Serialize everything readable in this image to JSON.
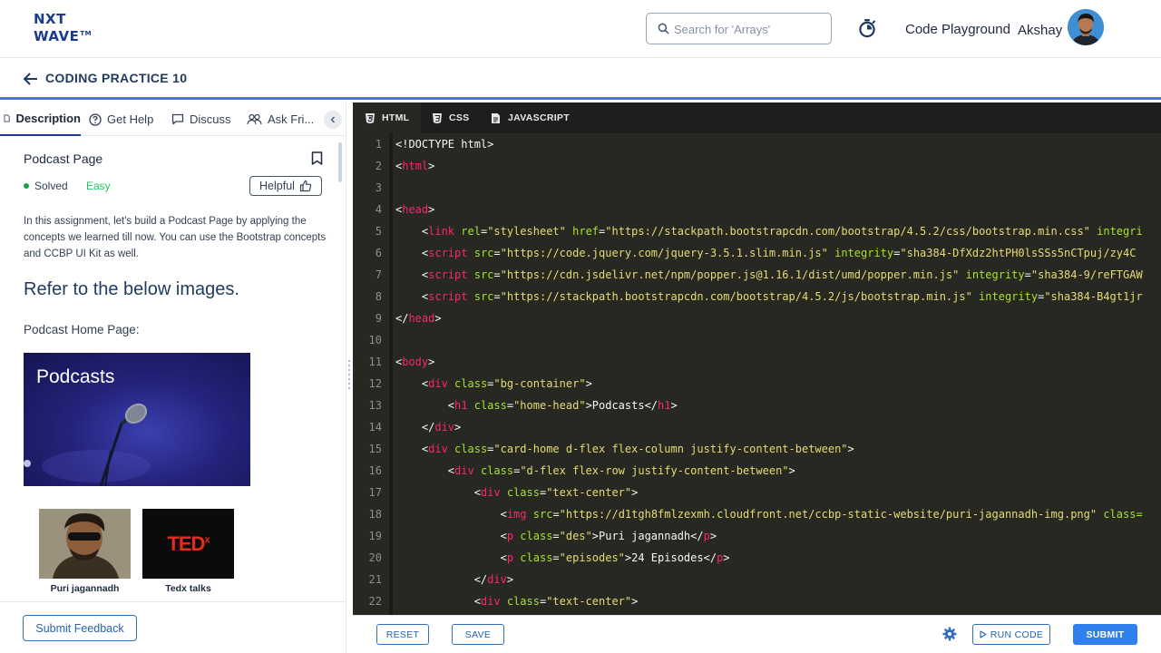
{
  "header": {
    "logo_line1": "NXT",
    "logo_line2": "WAVE",
    "logo_tm": "TM",
    "search_placeholder": "Search for 'Arrays'",
    "playground": "Code Playground",
    "username": "Akshay"
  },
  "subheader": {
    "title": "CODING PRACTICE 10"
  },
  "left_tabs": [
    {
      "label": "Description"
    },
    {
      "label": "Get Help"
    },
    {
      "label": "Discuss"
    },
    {
      "label": "Ask Fri..."
    }
  ],
  "question": {
    "title": "Podcast Page",
    "status": "Solved",
    "difficulty": "Easy",
    "helpful_label": "Helpful",
    "description": "In this assignment, let's build a Podcast Page by applying the concepts we learned till now. You can use the Bootstrap concepts and CCBP UI Kit as well.",
    "refer": "Refer to the below images.",
    "home_label": "Podcast Home Page:",
    "image_title": "Podcasts",
    "cards": [
      {
        "caption": "Puri jagannadh"
      },
      {
        "caption": "Tedx talks"
      }
    ],
    "ted_logo": "TED",
    "ted_x": "x"
  },
  "left_footer": {
    "feedback": "Submit Feedback"
  },
  "editor_tabs": [
    {
      "label": "HTML"
    },
    {
      "label": "CSS"
    },
    {
      "label": "JAVASCRIPT"
    }
  ],
  "code_lines": [
    [
      [
        "w",
        "<!DOCTYPE html>"
      ]
    ],
    [
      [
        "w",
        "<"
      ],
      [
        "t",
        "html"
      ],
      [
        "w",
        ">"
      ]
    ],
    [],
    [
      [
        "w",
        "<"
      ],
      [
        "t",
        "head"
      ],
      [
        "w",
        ">"
      ]
    ],
    [
      [
        "w",
        "    <"
      ],
      [
        "t",
        "link"
      ],
      [
        "w",
        " "
      ],
      [
        "a",
        "rel"
      ],
      [
        "w",
        "="
      ],
      [
        "s",
        "\"stylesheet\""
      ],
      [
        "w",
        " "
      ],
      [
        "a",
        "href"
      ],
      [
        "w",
        "="
      ],
      [
        "s",
        "\"https://stackpath.bootstrapcdn.com/bootstrap/4.5.2/css/bootstrap.min.css\""
      ],
      [
        "w",
        " "
      ],
      [
        "a",
        "integri"
      ]
    ],
    [
      [
        "w",
        "    <"
      ],
      [
        "t",
        "script"
      ],
      [
        "w",
        " "
      ],
      [
        "a",
        "src"
      ],
      [
        "w",
        "="
      ],
      [
        "s",
        "\"https://code.jquery.com/jquery-3.5.1.slim.min.js\""
      ],
      [
        "w",
        " "
      ],
      [
        "a",
        "integrity"
      ],
      [
        "w",
        "="
      ],
      [
        "s",
        "\"sha384-DfXdz2htPH0lsSSs5nCTpuj/zy4C"
      ]
    ],
    [
      [
        "w",
        "    <"
      ],
      [
        "t",
        "script"
      ],
      [
        "w",
        " "
      ],
      [
        "a",
        "src"
      ],
      [
        "w",
        "="
      ],
      [
        "s",
        "\"https://cdn.jsdelivr.net/npm/popper.js@1.16.1/dist/umd/popper.min.js\""
      ],
      [
        "w",
        " "
      ],
      [
        "a",
        "integrity"
      ],
      [
        "w",
        "="
      ],
      [
        "s",
        "\"sha384-9/reFTGAW"
      ]
    ],
    [
      [
        "w",
        "    <"
      ],
      [
        "t",
        "script"
      ],
      [
        "w",
        " "
      ],
      [
        "a",
        "src"
      ],
      [
        "w",
        "="
      ],
      [
        "s",
        "\"https://stackpath.bootstrapcdn.com/bootstrap/4.5.2/js/bootstrap.min.js\""
      ],
      [
        "w",
        " "
      ],
      [
        "a",
        "integrity"
      ],
      [
        "w",
        "="
      ],
      [
        "s",
        "\"sha384-B4gt1jr"
      ]
    ],
    [
      [
        "w",
        "</"
      ],
      [
        "t",
        "head"
      ],
      [
        "w",
        ">"
      ]
    ],
    [],
    [
      [
        "w",
        "<"
      ],
      [
        "t",
        "body"
      ],
      [
        "w",
        ">"
      ]
    ],
    [
      [
        "w",
        "    <"
      ],
      [
        "t",
        "div"
      ],
      [
        "w",
        " "
      ],
      [
        "a",
        "class"
      ],
      [
        "w",
        "="
      ],
      [
        "s",
        "\"bg-container\""
      ],
      [
        "w",
        ">"
      ]
    ],
    [
      [
        "w",
        "        <"
      ],
      [
        "t",
        "h1"
      ],
      [
        "w",
        " "
      ],
      [
        "a",
        "class"
      ],
      [
        "w",
        "="
      ],
      [
        "s",
        "\"home-head\""
      ],
      [
        "w",
        ">Podcasts</"
      ],
      [
        "t",
        "h1"
      ],
      [
        "w",
        ">"
      ]
    ],
    [
      [
        "w",
        "    </"
      ],
      [
        "t",
        "div"
      ],
      [
        "w",
        ">"
      ]
    ],
    [
      [
        "w",
        "    <"
      ],
      [
        "t",
        "div"
      ],
      [
        "w",
        " "
      ],
      [
        "a",
        "class"
      ],
      [
        "w",
        "="
      ],
      [
        "s",
        "\"card-home d-flex flex-column justify-content-between\""
      ],
      [
        "w",
        ">"
      ]
    ],
    [
      [
        "w",
        "        <"
      ],
      [
        "t",
        "div"
      ],
      [
        "w",
        " "
      ],
      [
        "a",
        "class"
      ],
      [
        "w",
        "="
      ],
      [
        "s",
        "\"d-flex flex-row justify-content-between\""
      ],
      [
        "w",
        ">"
      ]
    ],
    [
      [
        "w",
        "            <"
      ],
      [
        "t",
        "div"
      ],
      [
        "w",
        " "
      ],
      [
        "a",
        "class"
      ],
      [
        "w",
        "="
      ],
      [
        "s",
        "\"text-center\""
      ],
      [
        "w",
        ">"
      ]
    ],
    [
      [
        "w",
        "                <"
      ],
      [
        "t",
        "img"
      ],
      [
        "w",
        " "
      ],
      [
        "a",
        "src"
      ],
      [
        "w",
        "="
      ],
      [
        "s",
        "\"https://d1tgh8fmlzexmh.cloudfront.net/ccbp-static-website/puri-jagannadh-img.png\""
      ],
      [
        "w",
        " "
      ],
      [
        "a",
        "class="
      ]
    ],
    [
      [
        "w",
        "                <"
      ],
      [
        "t",
        "p"
      ],
      [
        "w",
        " "
      ],
      [
        "a",
        "class"
      ],
      [
        "w",
        "="
      ],
      [
        "s",
        "\"des\""
      ],
      [
        "w",
        ">Puri jagannadh</"
      ],
      [
        "t",
        "p"
      ],
      [
        "w",
        ">"
      ]
    ],
    [
      [
        "w",
        "                <"
      ],
      [
        "t",
        "p"
      ],
      [
        "w",
        " "
      ],
      [
        "a",
        "class"
      ],
      [
        "w",
        "="
      ],
      [
        "s",
        "\"episodes\""
      ],
      [
        "w",
        ">24 Episodes</"
      ],
      [
        "t",
        "p"
      ],
      [
        "w",
        ">"
      ]
    ],
    [
      [
        "w",
        "            </"
      ],
      [
        "t",
        "div"
      ],
      [
        "w",
        ">"
      ]
    ],
    [
      [
        "w",
        "            <"
      ],
      [
        "t",
        "div"
      ],
      [
        "w",
        " "
      ],
      [
        "a",
        "class"
      ],
      [
        "w",
        "="
      ],
      [
        "s",
        "\"text-center\""
      ],
      [
        "w",
        ">"
      ]
    ]
  ],
  "bottom_bar": {
    "reset": "RESET",
    "save": "SAVE",
    "run": "RUN CODE",
    "submit": "SUBMIT"
  },
  "colors": {
    "brand": "#1a3b8e",
    "accent": "#2f80ed",
    "editor_bg": "#272822",
    "tag": "#f92672",
    "attr": "#a6e22e",
    "string": "#e6db74"
  }
}
